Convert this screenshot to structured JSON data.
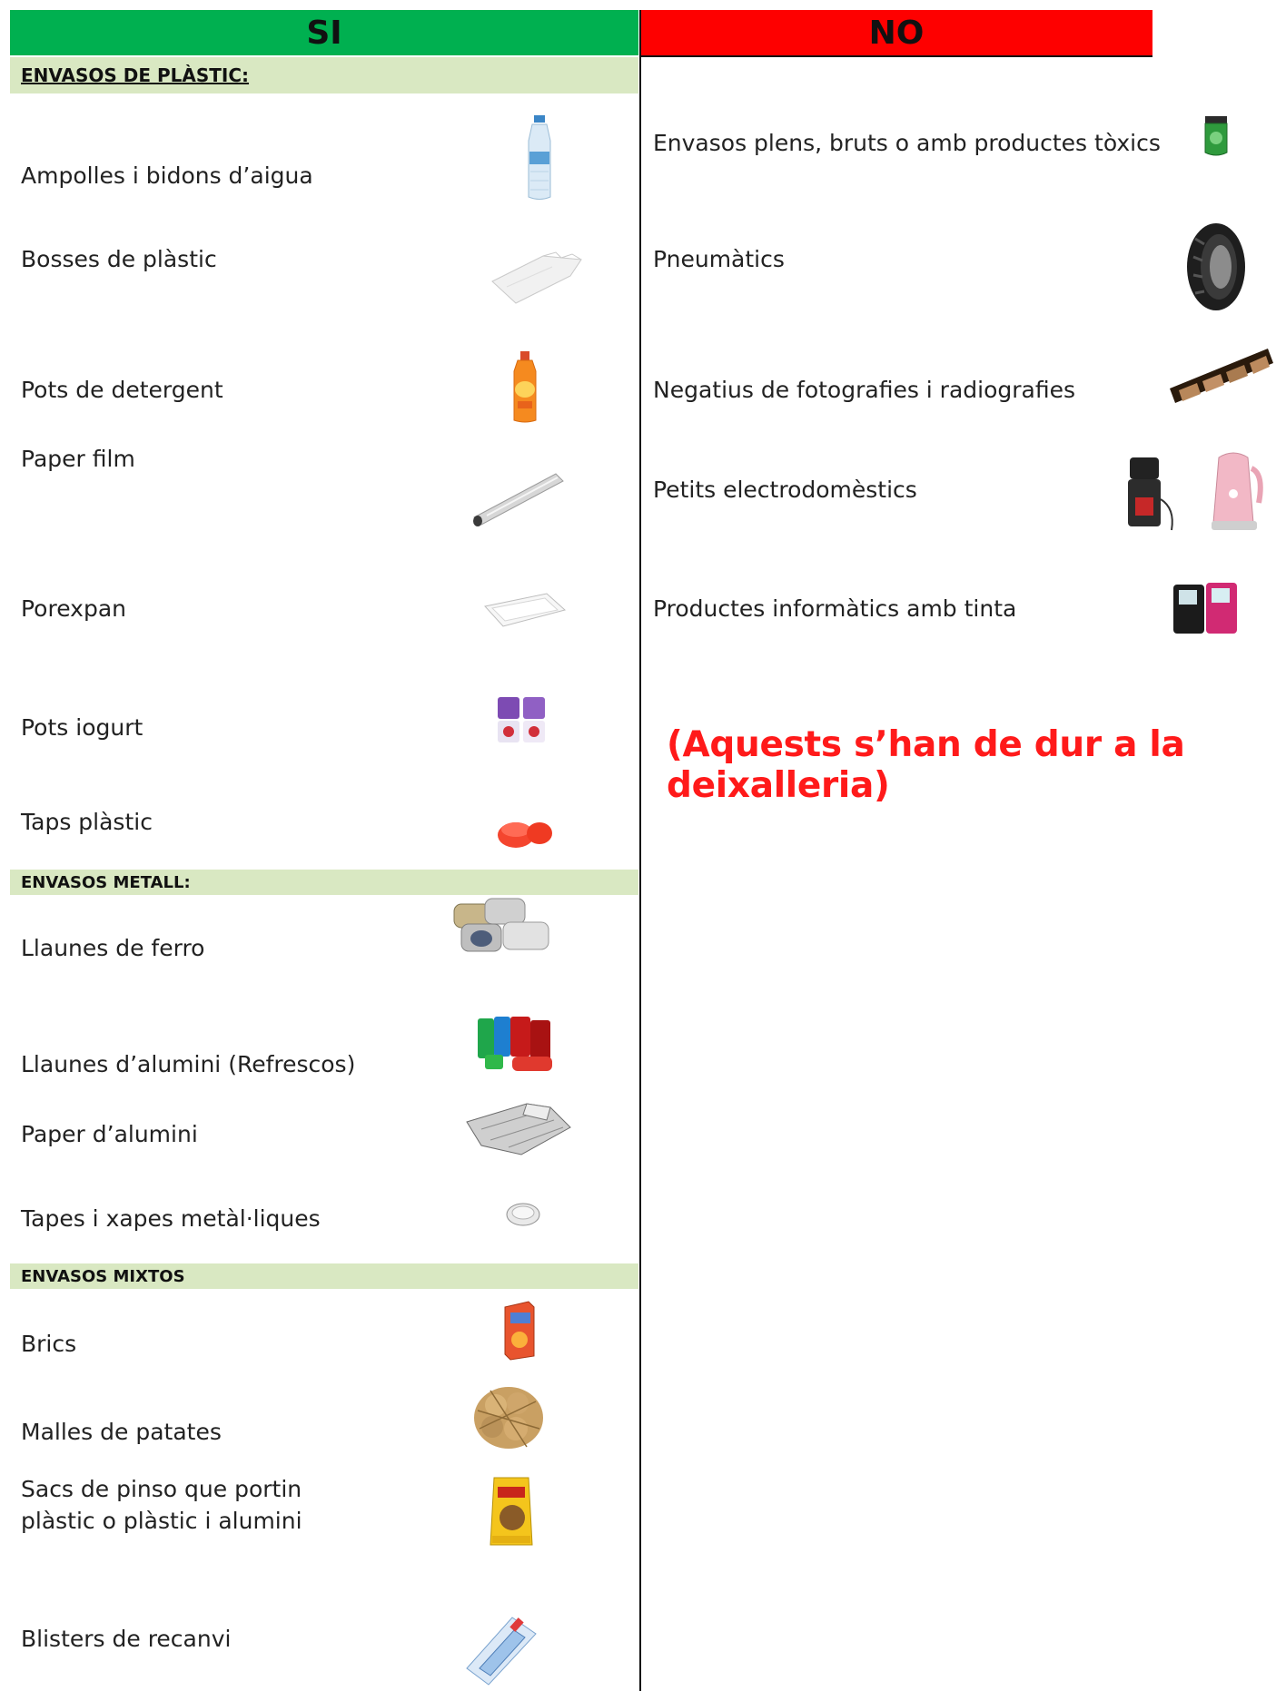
{
  "header": {
    "yes_label": "SI",
    "no_label": "NO"
  },
  "sections": {
    "plastic": "ENVASOS DE PLÀSTIC:",
    "metall": "ENVASOS METALL:",
    "mixtos": "ENVASOS MIXTOS"
  },
  "yes_items": {
    "water_bottles": "Ampolles i bidons d’aigua",
    "plastic_bags": "Bosses de plàstic",
    "detergent": "Pots de detergent",
    "cling_film": "Paper film",
    "styrofoam": "Porexpan",
    "yogurt": "Pots iogurt",
    "plastic_caps": "Taps plàstic",
    "iron_cans": "Llaunes de ferro",
    "aluminium_cans": "Llaunes d’alumini (Refrescos)",
    "aluminium_foil": "Paper d’alumini",
    "metal_lids": "Tapes i xapes metàl·liques",
    "cartons": "Brics",
    "potato_nets": "Malles de patates",
    "feed_bags_line1": "Sacs de pinso que portin",
    "feed_bags_line2": "plàstic o plàstic i alumini",
    "blisters": "Blisters de recanvi"
  },
  "no_items": {
    "dirty_containers": "Envasos plens, bruts o amb productes tòxics",
    "tyres": "Pneumàtics",
    "negatives": "Negatius de fotografies i radiografies",
    "appliances": "Petits electrodomèstics",
    "ink_products": "Productes informàtics amb tinta"
  },
  "note": "(Aquests s’han de dur a la deixalleria)",
  "colors": {
    "yes": "#00b050",
    "no": "#fe0000",
    "section": "#d9e8c2",
    "note": "#ff1a1a"
  }
}
